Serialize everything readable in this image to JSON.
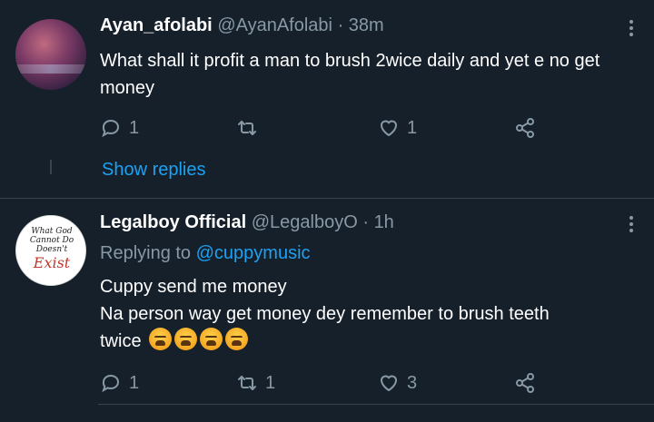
{
  "tweets": [
    {
      "name": "Ayan_afolabi",
      "handle": "@AyanAfolabi",
      "separator": "·",
      "time": "38m",
      "text": "What shall it profit a man to brush 2wice daily and yet e no get money",
      "replies": "1",
      "retweets": "",
      "likes": "1",
      "show_replies": "Show replies"
    },
    {
      "name": "Legalboy Official",
      "handle": "@LegalboyO",
      "separator": "·",
      "time": "1h",
      "replying_prefix": "Replying to",
      "replying_to": "@cuppymusic",
      "text_lines": [
        "Cuppy send me money",
        "Na person way get money dey remember to brush teeth",
        "twice"
      ],
      "emoji_count": 4,
      "avatar_text": [
        "What God",
        "Cannot Do",
        "Doesn't",
        "Exist"
      ],
      "replies": "1",
      "retweets": "1",
      "likes": "3"
    }
  ],
  "icons": {
    "reply": "reply-icon",
    "retweet": "retweet-icon",
    "like": "heart-icon",
    "share": "share-icon",
    "more": "more-options-icon"
  },
  "colors": {
    "background": "#15202b",
    "secondary_text": "#8899a6",
    "link": "#1da1f2",
    "divider": "#38444d"
  }
}
